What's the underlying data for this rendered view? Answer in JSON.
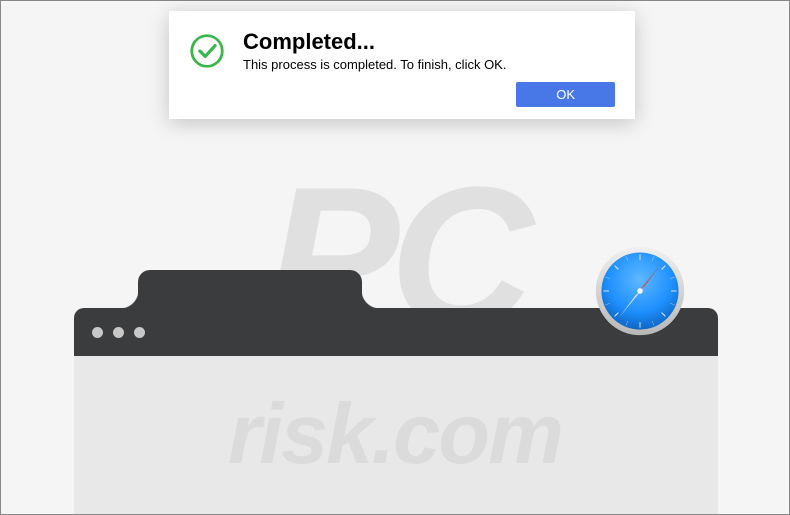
{
  "dialog": {
    "title": "Completed...",
    "message": "This process is completed. To finish, click OK.",
    "ok_label": "OK"
  },
  "watermark": {
    "top": "PC",
    "bottom": "risk.com"
  },
  "icons": {
    "check": "completed-checkmark",
    "safari": "safari-browser-icon"
  },
  "colors": {
    "accent_button": "#4878e8",
    "check_green": "#3ab54a",
    "browser_chrome": "#3a3c3d",
    "safari_blue": "#1e90ff",
    "safari_red": "#e74c3c"
  }
}
